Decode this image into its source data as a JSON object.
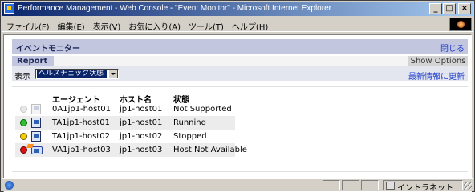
{
  "window": {
    "title": "Performance Management - Web Console - \"Event Monitor\" - Microsoft Internet Explorer",
    "minimize": "_",
    "maximize": "□",
    "close": "×"
  },
  "menu": [
    "ファイル(F)",
    "編集(E)",
    "表示(V)",
    "お気に入り(A)",
    "ツール(T)",
    "ヘルプ(H)"
  ],
  "panel": {
    "title": "イベントモニター",
    "close_label": "閉じる",
    "report_tab": "Report",
    "show_options": "Show Options",
    "filter_label": "表示",
    "filter_value": "ヘルスチェック状態",
    "refresh_label": "最新情報に更新"
  },
  "table": {
    "columns": [
      "エージェント",
      "ホスト名",
      "状態"
    ],
    "rows": [
      {
        "agent": "0A1jp1-host01",
        "host": "jp1-host01",
        "status": "Not Supported",
        "indicator": "grey"
      },
      {
        "agent": "TA1jp1-host01",
        "host": "jp1-host01",
        "status": "Running",
        "indicator": "green"
      },
      {
        "agent": "TA1jp1-host02",
        "host": "jp1-host02",
        "status": "Stopped",
        "indicator": "yellow"
      },
      {
        "agent": "VA1jp1-host03",
        "host": "jp1-host03",
        "status": "Host Not Available",
        "indicator": "red"
      }
    ]
  },
  "statusbar": {
    "zone": "イントラネット"
  }
}
